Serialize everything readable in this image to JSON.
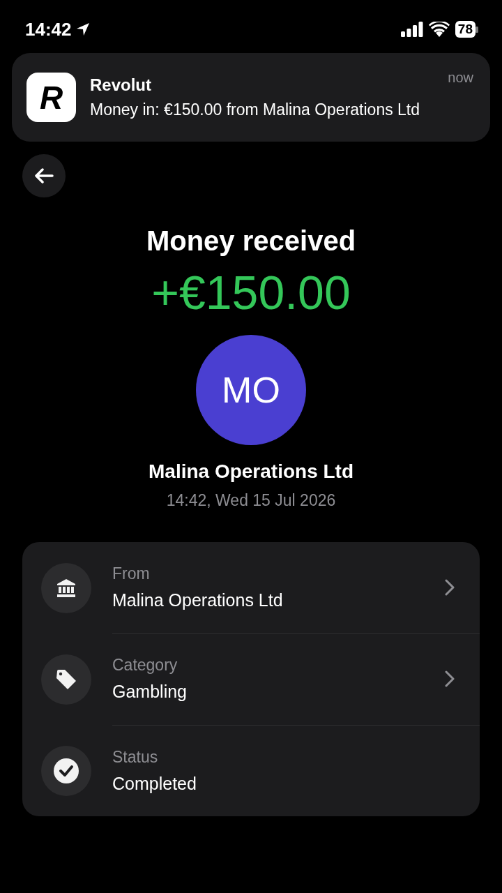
{
  "status_bar": {
    "time": "14:42",
    "battery": "78"
  },
  "notification": {
    "app_logo": "R",
    "app": "Revolut",
    "time": "now",
    "message": "Money in: €150.00 from Malina Operations Ltd"
  },
  "header": {
    "title": "Money received",
    "amount": "+€150.00",
    "avatar": "MO",
    "name": "Malina Operations Ltd",
    "date": "14:42, Wed 15 Jul 2026"
  },
  "details": [
    {
      "kind": "bank",
      "label": "From",
      "value": "Malina Operations Ltd",
      "chevron": true
    },
    {
      "kind": "tag",
      "label": "Category",
      "value": "Gambling",
      "chevron": true
    },
    {
      "kind": "check",
      "label": "Status",
      "value": "Completed",
      "chevron": false
    }
  ]
}
